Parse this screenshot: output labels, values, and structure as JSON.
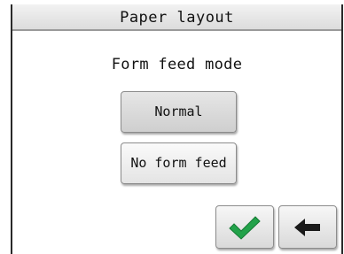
{
  "title": "Paper layout",
  "heading": "Form feed mode",
  "options": [
    {
      "label": "Normal",
      "selected": true
    },
    {
      "label": "No form feed",
      "selected": false
    }
  ],
  "icons": {
    "ok": "checkmark-icon",
    "back": "back-arrow-icon"
  },
  "colors": {
    "ok_check": "#22a24a",
    "back_arrow": "#1a1a1a"
  }
}
